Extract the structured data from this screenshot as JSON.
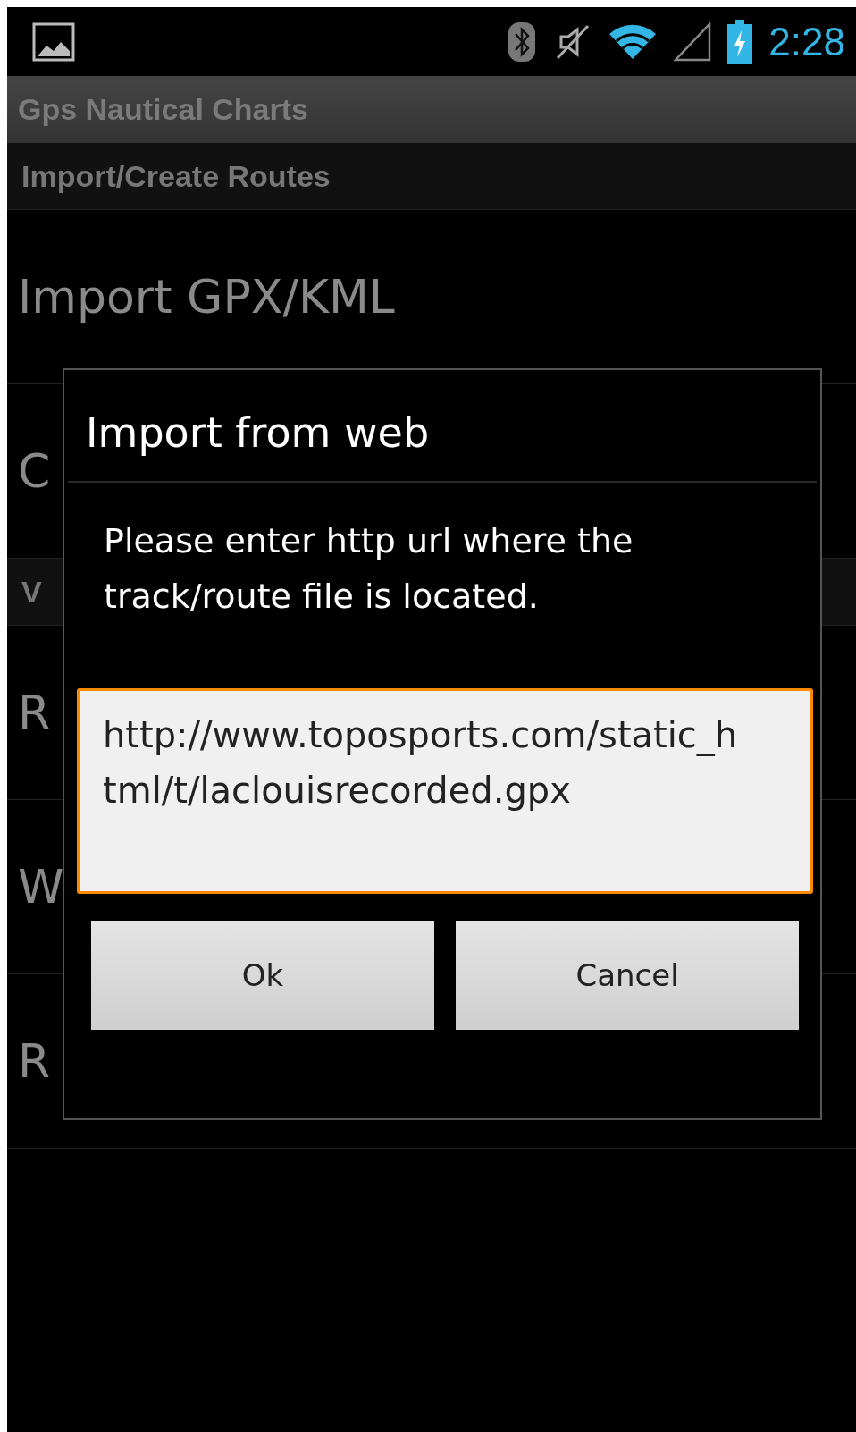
{
  "status_bar": {
    "time": "2:28"
  },
  "action_bar": {
    "title": "Gps Nautical Charts"
  },
  "sections": [
    {
      "header": "Import/Create Routes",
      "items": [
        "Import GPX/KML",
        "C"
      ]
    },
    {
      "header": "V",
      "items": [
        "R",
        "W",
        "R"
      ]
    }
  ],
  "dialog": {
    "title": "Import from web",
    "message": "Please enter http url where the track/route file is located.",
    "input": {
      "value": "http://www.toposports.com/static_html/t/laclouisrecorded.gpx",
      "focused": true
    },
    "buttons": [
      "Ok",
      "Cancel"
    ]
  }
}
